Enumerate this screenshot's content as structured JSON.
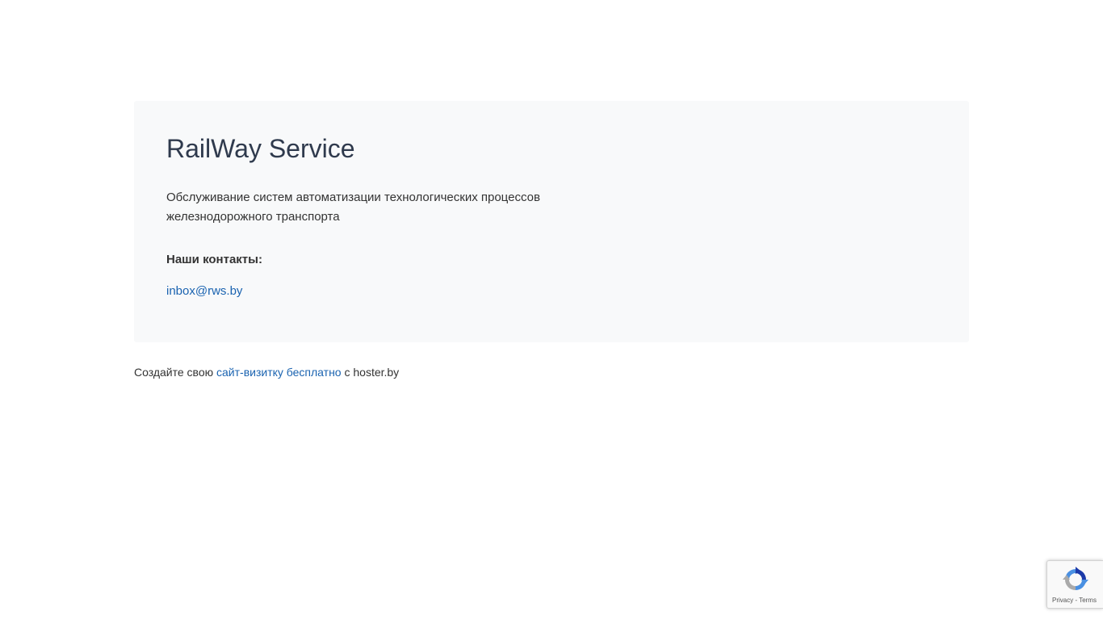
{
  "card": {
    "title": "RailWay Service",
    "description": "Обслуживание систем автоматизации технологических процессов железнодорожного транспорта",
    "contacts_heading": "Наши контакты:",
    "email": "inbox@rws.by"
  },
  "footer": {
    "prefix": "Создайте свою ",
    "link_label": "сайт-визитку бесплатно",
    "suffix": " с hoster.by"
  },
  "recaptcha": {
    "icon": "recaptcha-icon",
    "terms": "Privacy - Terms"
  },
  "colors": {
    "link": "#1a63b0",
    "card_bg": "#f8f9fa",
    "title": "#2f3a4d"
  }
}
